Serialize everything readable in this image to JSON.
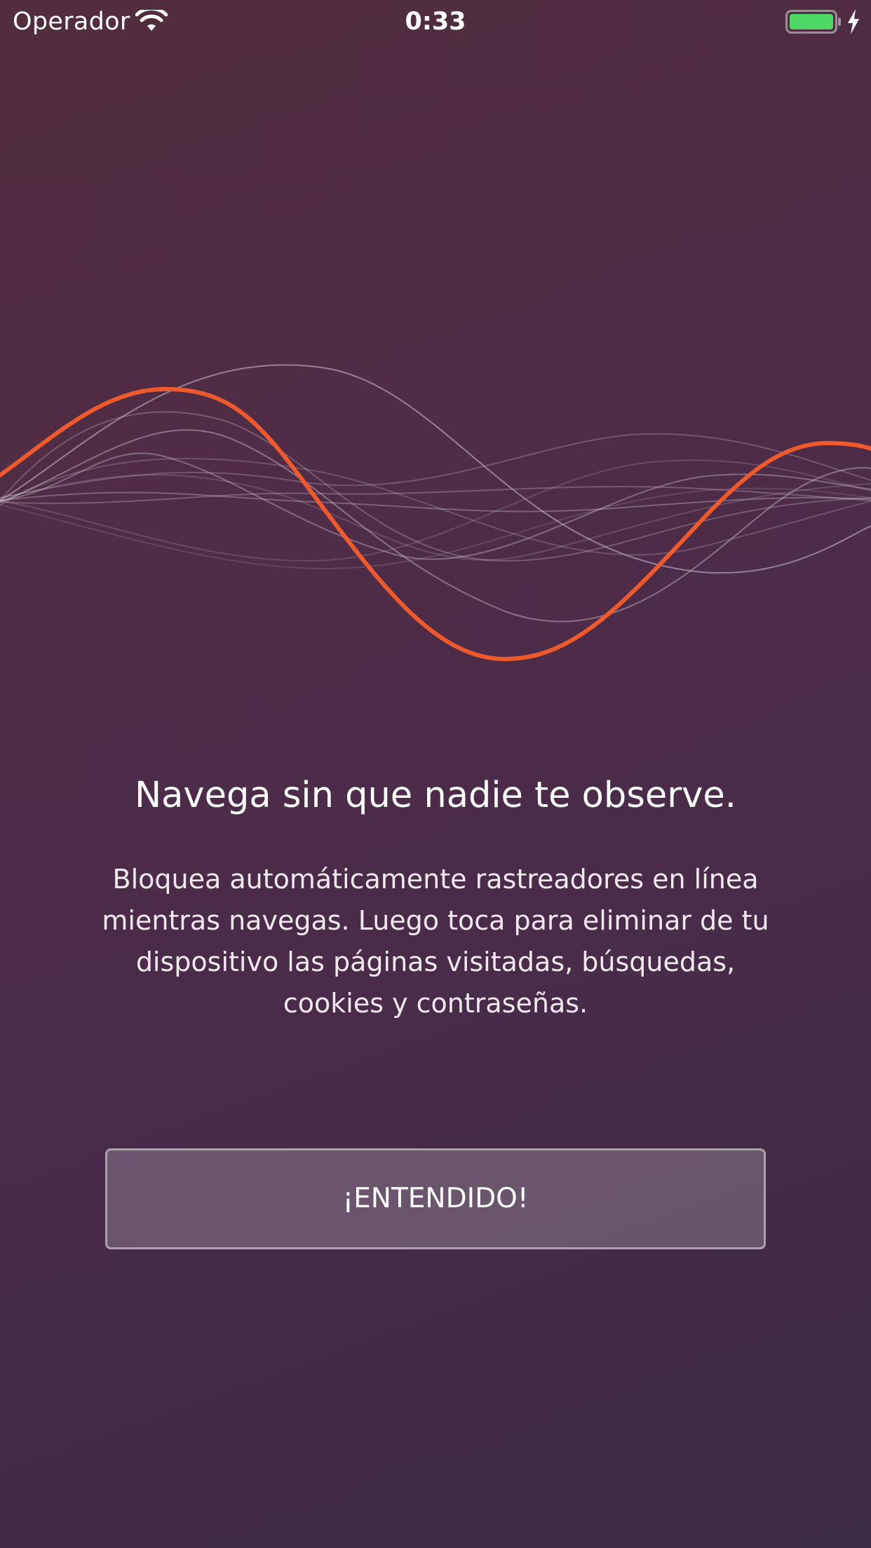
{
  "status_bar": {
    "carrier": "Operador",
    "time": "0:33",
    "wifi_icon": "wifi-icon",
    "battery_icon": "battery-full-icon",
    "charging_icon": "charging-bolt-icon",
    "battery_color": "#4cd964"
  },
  "onboarding": {
    "illustration": "sound-wave-illustration",
    "accent_color": "#ef5a2c",
    "title": "Navega sin que nadie te observe.",
    "description": "Bloquea automáticamente rastreadores en línea mientras navegas. Luego toca para eliminar de tu dispositivo las páginas visitadas, búsquedas, cookies y contraseñas.",
    "button_label": "¡ENTENDIDO!"
  }
}
